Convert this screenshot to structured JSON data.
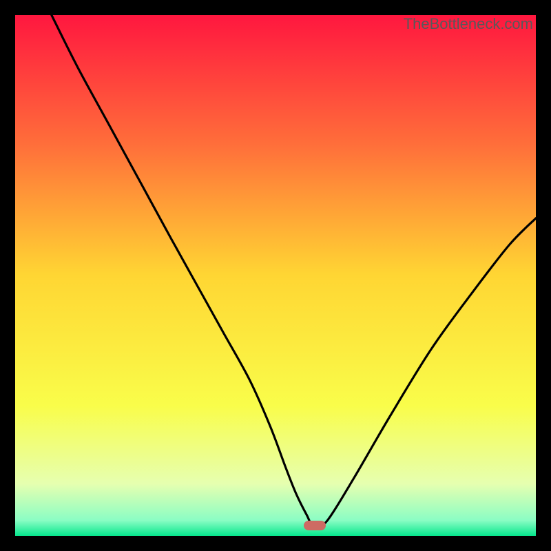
{
  "watermark": "TheBottleneck.com",
  "chart_data": {
    "type": "line",
    "title": "",
    "xlabel": "",
    "ylabel": "",
    "xlim": [
      0,
      100
    ],
    "ylim": [
      0,
      100
    ],
    "x": [
      7,
      12,
      18,
      24,
      30,
      35,
      40,
      45,
      49,
      52,
      54,
      56,
      57.5,
      60,
      65,
      72,
      80,
      88,
      95,
      100
    ],
    "values": [
      100,
      90,
      79,
      68,
      57,
      48,
      39,
      30,
      21,
      13,
      8,
      4,
      1.5,
      3,
      11,
      23,
      36,
      47,
      56,
      61
    ],
    "marker": {
      "x": 57.5,
      "y": 2,
      "color": "#ce6b63"
    },
    "gradient_stops": [
      {
        "pct": 0,
        "color": "#ff173f"
      },
      {
        "pct": 25,
        "color": "#ff6f3a"
      },
      {
        "pct": 50,
        "color": "#ffd633"
      },
      {
        "pct": 75,
        "color": "#f9fd4a"
      },
      {
        "pct": 90,
        "color": "#e6ffb0"
      },
      {
        "pct": 97,
        "color": "#8bfdc4"
      },
      {
        "pct": 100,
        "color": "#06e78d"
      }
    ]
  }
}
